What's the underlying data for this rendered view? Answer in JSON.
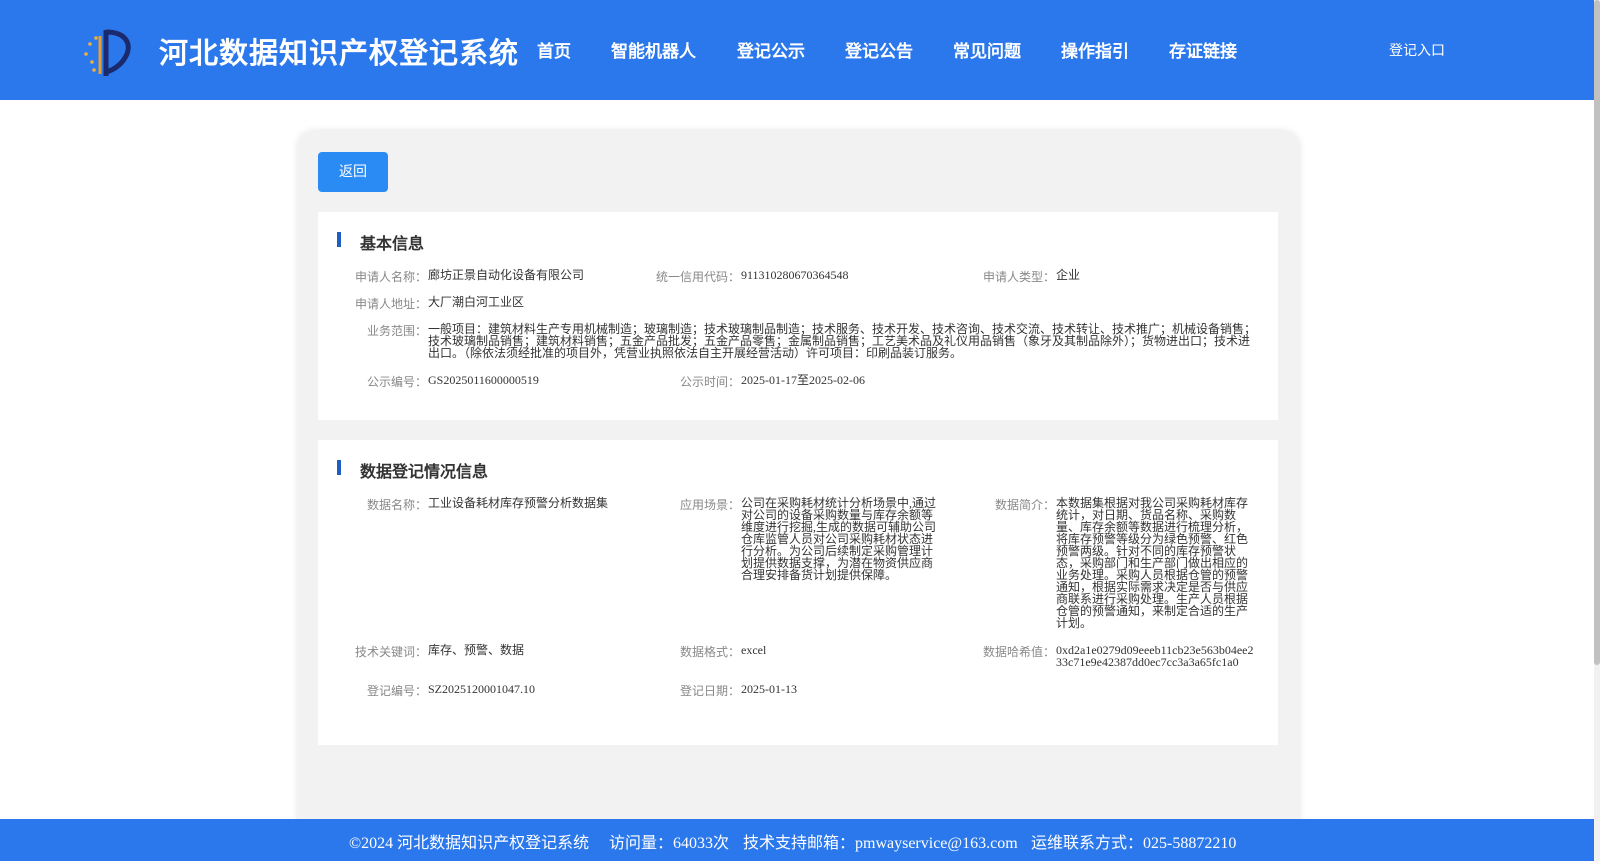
{
  "header": {
    "site_title": "河北数据知识产权登记系统",
    "logo_icon": "emblem-logo-icon",
    "nav": [
      "首页",
      "智能机器人",
      "登记公示",
      "登记公告",
      "常见问题",
      "操作指引",
      "存证链接"
    ],
    "login_label": "登记入口"
  },
  "back_label": "返回",
  "basic": {
    "title": "基本信息",
    "applicant_name_label": "申请人名称：",
    "applicant_name": "廊坊正景自动化设备有限公司",
    "credit_code_label": "统一信用代码：",
    "credit_code": "911310280670364548",
    "applicant_type_label": "申请人类型：",
    "applicant_type": "企业",
    "address_label": "申请人地址：",
    "address": "大厂潮白河工业区",
    "scope_label": "业务范围：",
    "scope": "一般项目：建筑材料生产专用机械制造；玻璃制造；技术玻璃制品制造；技术服务、技术开发、技术咨询、技术交流、技术转让、技术推广；机械设备销售；技术玻璃制品销售；建筑材料销售；五金产品批发；五金产品零售；金属制品销售；工艺美术品及礼仪用品销售（象牙及其制品除外）；货物进出口；技术进出口。（除依法须经批准的项目外，凭营业执照依法自主开展经营活动）许可项目：印刷品装订服务。",
    "notice_no_label": "公示编号：",
    "notice_no": "GS2025011600000519",
    "notice_time_label": "公示时间：",
    "notice_time": "2025-01-17至2025-02-06"
  },
  "registration": {
    "title": "数据登记情况信息",
    "data_name_label": "数据名称：",
    "data_name": "工业设备耗材库存预警分析数据集",
    "scenario_label": "应用场景：",
    "scenario": "公司在采购耗材统计分析场景中,通过对公司的设备采购数量与库存余额等维度进行挖掘,生成的数据可辅助公司仓库监管人员对公司采购耗材状态进行分析。为公司后续制定采购管理计划提供数据支撑，为潜在物资供应商合理安排备货计划提供保障。",
    "summary_label": "数据简介：",
    "summary": "本数据集根据对我公司采购耗材库存统计，对日期、货品名称、采购数量、库存余额等数据进行梳理分析，将库存预警等级分为绿色预警、红色预警两级。针对不同的库存预警状态，采购部门和生产部门做出相应的业务处理。采购人员根据仓管的预警通知，根据实际需求决定是否与供应商联系进行采购处理。生产人员根据仓管的预警通知，来制定合适的生产计划。",
    "keywords_label": "技术关键词：",
    "keywords": "库存、预警、数据",
    "format_label": "数据格式：",
    "format": "excel",
    "hash_label": "数据哈希值：",
    "hash": "0xd2a1e0279d09eeeb11cb23e563b04ee233c71e9e42387dd0ec7cc3a3a65fc1a0",
    "reg_no_label": "登记编号：",
    "reg_no": "SZ2025120001047.10",
    "reg_date_label": "登记日期：",
    "reg_date": "2025-01-13"
  },
  "footer": {
    "copyright": "©2024 河北数据知识产权登记系统",
    "visits": "访问量：64033次",
    "email": "技术支持邮箱：pmwayservice@163.com",
    "phone": "运维联系方式：025-58872210"
  },
  "colors": {
    "header_bg": "#2b78ec",
    "button_bg": "#2b8bf4",
    "section_bar": "#1f5fc4",
    "card_bg": "#f2f2f2"
  }
}
